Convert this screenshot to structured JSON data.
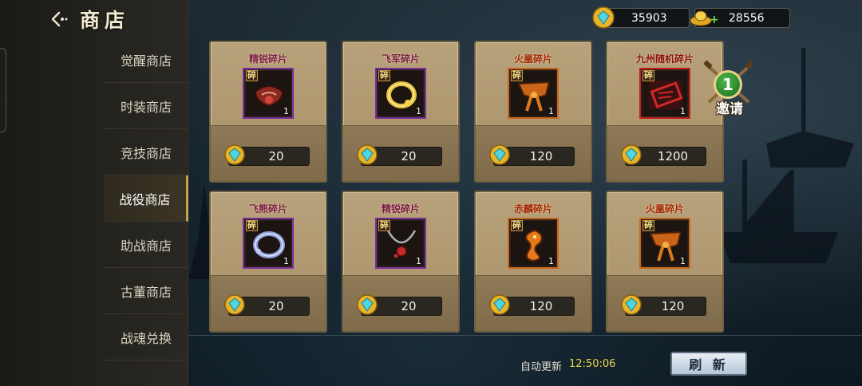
{
  "header": {
    "title": "商店"
  },
  "currencies": {
    "gems": "35903",
    "gold": "28556"
  },
  "sidebar": {
    "items": [
      {
        "label": "觉醒商店",
        "active": false
      },
      {
        "label": "时装商店",
        "active": false
      },
      {
        "label": "竞技商店",
        "active": false
      },
      {
        "label": "战役商店",
        "active": true
      },
      {
        "label": "助战商店",
        "active": false
      },
      {
        "label": "古董商店",
        "active": false
      },
      {
        "label": "战魂兑换",
        "active": false
      }
    ]
  },
  "items": [
    {
      "name": "精锐碎片",
      "badge": "碎",
      "qty": "1",
      "price": "20",
      "icon": "red-belt-icon",
      "rarity": "purple"
    },
    {
      "name": "飞军碎片",
      "badge": "碎",
      "qty": "1",
      "price": "20",
      "icon": "gold-ring-icon",
      "rarity": "purple"
    },
    {
      "name": "火凰碎片",
      "badge": "碎",
      "qty": "1",
      "price": "120",
      "icon": "orange-belt-icon",
      "rarity": "orange"
    },
    {
      "name": "九州随机碎片",
      "badge": "碎",
      "qty": "1",
      "price": "1200",
      "icon": "random-seal-icon",
      "rarity": "red"
    },
    {
      "name": "飞熊碎片",
      "badge": "碎",
      "qty": "1",
      "price": "20",
      "icon": "silver-ring-icon",
      "rarity": "purple"
    },
    {
      "name": "精锐碎片",
      "badge": "碎",
      "qty": "1",
      "price": "20",
      "icon": "pendant-icon",
      "rarity": "purple"
    },
    {
      "name": "赤麟碎片",
      "badge": "碎",
      "qty": "1",
      "price": "120",
      "icon": "dragon-icon",
      "rarity": "orange"
    },
    {
      "name": "火凰碎片",
      "badge": "碎",
      "qty": "1",
      "price": "120",
      "icon": "orange-belt-icon",
      "rarity": "orange"
    }
  ],
  "invite": {
    "count": "1",
    "label": "邀请"
  },
  "footer": {
    "refresh_label": "自动更新",
    "refresh_time": "12:50:06",
    "refresh_button": "刷 新"
  }
}
